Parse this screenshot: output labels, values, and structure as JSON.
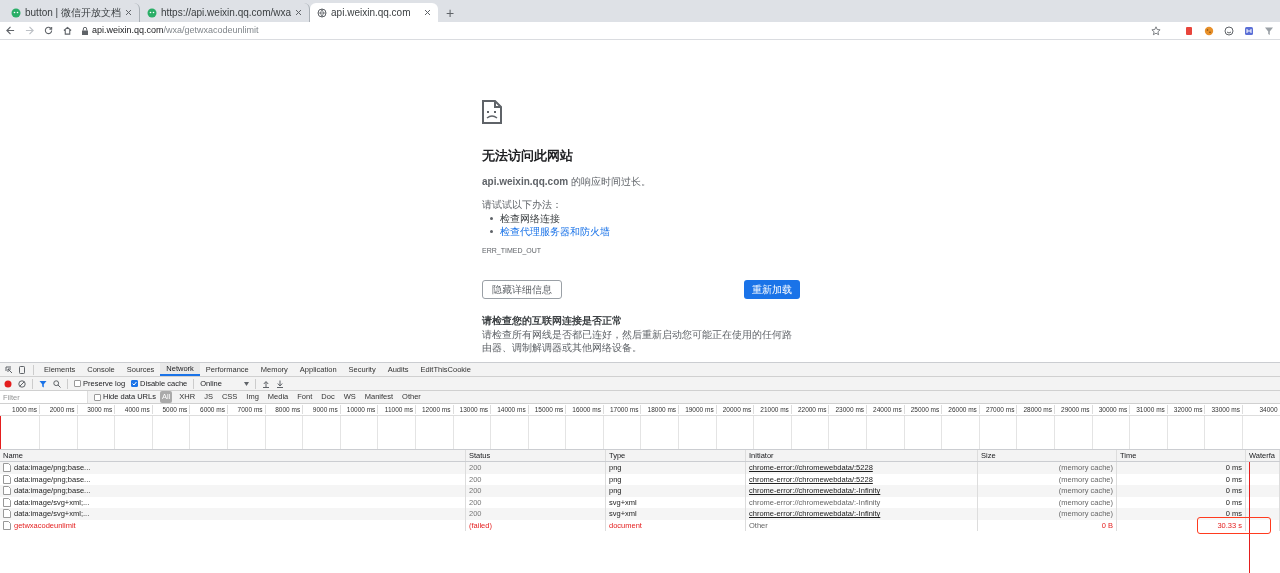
{
  "browser": {
    "tabs": [
      {
        "title": "button | 微信开放文档",
        "selected": false
      },
      {
        "title": "https://api.weixin.qq.com/wxa",
        "selected": false
      },
      {
        "title": "api.weixin.qq.com",
        "selected": true
      }
    ],
    "new_tab": "+",
    "address": {
      "host": "api.weixin.qq.com",
      "path": "/wxa/getwxacodeunlimit"
    }
  },
  "error_page": {
    "title": "无法访问此网站",
    "message": "**api.weixin.qq.com** 的响应时间过长。",
    "try_heading": "请试试以下办法：",
    "suggestions": [
      {
        "text": "检查网络连接",
        "link": false
      },
      {
        "text": "检查代理服务器和防火墙",
        "link": true
      }
    ],
    "error_code": "ERR_TIMED_OUT",
    "details_button": "隐藏详细信息",
    "reload_button": "重新加载",
    "details_heading": "请检查您的互联网连接是否正常",
    "details_text": "请检查所有网线是否都已连好，然后重新启动您可能正在使用的任何路由器、调制解调器或其他网络设备。"
  },
  "devtools": {
    "panels": [
      {
        "label": "Elements",
        "selected": false
      },
      {
        "label": "Console",
        "selected": false
      },
      {
        "label": "Sources",
        "selected": false
      },
      {
        "label": "Network",
        "selected": true
      },
      {
        "label": "Performance",
        "selected": false
      },
      {
        "label": "Memory",
        "selected": false
      },
      {
        "label": "Application",
        "selected": false
      },
      {
        "label": "Security",
        "selected": false
      },
      {
        "label": "Audits",
        "selected": false
      },
      {
        "label": "EditThisCookie",
        "selected": false
      }
    ],
    "preserve_log": {
      "label": "Preserve log",
      "checked": false
    },
    "disable_cache": {
      "label": "Disable cache",
      "checked": true
    },
    "throttling": "Online",
    "filter": {
      "placeholder": "Filter"
    },
    "hide_data_urls": {
      "label": "Hide data URLs",
      "checked": false
    },
    "types": [
      {
        "label": "All",
        "selected": true
      },
      {
        "label": "XHR",
        "selected": false
      },
      {
        "label": "JS",
        "selected": false
      },
      {
        "label": "CSS",
        "selected": false
      },
      {
        "label": "Img",
        "selected": false
      },
      {
        "label": "Media",
        "selected": false
      },
      {
        "label": "Font",
        "selected": false
      },
      {
        "label": "Doc",
        "selected": false
      },
      {
        "label": "WS",
        "selected": false
      },
      {
        "label": "Manifest",
        "selected": false
      },
      {
        "label": "Other",
        "selected": false
      }
    ],
    "timeline_ticks": [
      "1000 ms",
      "2000 ms",
      "3000 ms",
      "4000 ms",
      "5000 ms",
      "6000 ms",
      "7000 ms",
      "8000 ms",
      "9000 ms",
      "10000 ms",
      "11000 ms",
      "12000 ms",
      "13000 ms",
      "14000 ms",
      "15000 ms",
      "16000 ms",
      "17000 ms",
      "18000 ms",
      "19000 ms",
      "20000 ms",
      "21000 ms",
      "22000 ms",
      "23000 ms",
      "24000 ms",
      "25000 ms",
      "26000 ms",
      "27000 ms",
      "28000 ms",
      "29000 ms",
      "30000 ms",
      "31000 ms",
      "32000 ms",
      "33000 ms",
      "34000"
    ],
    "columns": [
      "Name",
      "Status",
      "Type",
      "Initiator",
      "Size",
      "Time",
      "Waterfa"
    ],
    "rows": [
      {
        "name": "data:image/png;base...",
        "status": "200",
        "type": "png",
        "initiator": "chrome-error://chromewebdata/:5228",
        "initiator_link": true,
        "size": "(memory cache)",
        "time": "0 ms",
        "failed": false,
        "highlighted": false
      },
      {
        "name": "data:image/png;base...",
        "status": "200",
        "type": "png",
        "initiator": "chrome-error://chromewebdata/:5228",
        "initiator_link": true,
        "size": "(memory cache)",
        "time": "0 ms",
        "failed": false,
        "highlighted": false
      },
      {
        "name": "data:image/png;base...",
        "status": "200",
        "type": "png",
        "initiator": "chrome-error://chromewebdata/:-Infinity",
        "initiator_link": true,
        "size": "(memory cache)",
        "time": "0 ms",
        "failed": false,
        "highlighted": false
      },
      {
        "name": "data:image/svg+xml;...",
        "status": "200",
        "type": "svg+xml",
        "initiator": "chrome-error://chromewebdata/:-Infinity",
        "initiator_link": false,
        "size": "(memory cache)",
        "time": "0 ms",
        "failed": false,
        "highlighted": false
      },
      {
        "name": "data:image/svg+xml;...",
        "status": "200",
        "type": "svg+xml",
        "initiator": "chrome-error://chromewebdata/:-Infinity",
        "initiator_link": true,
        "size": "(memory cache)",
        "time": "0 ms",
        "failed": false,
        "highlighted": false
      },
      {
        "name": "getwxacodeunlimit",
        "status": "(failed)",
        "type": "document",
        "initiator": "Other",
        "initiator_link": false,
        "size": "0 B",
        "time": "30.33 s",
        "failed": true,
        "highlighted": true
      }
    ]
  }
}
